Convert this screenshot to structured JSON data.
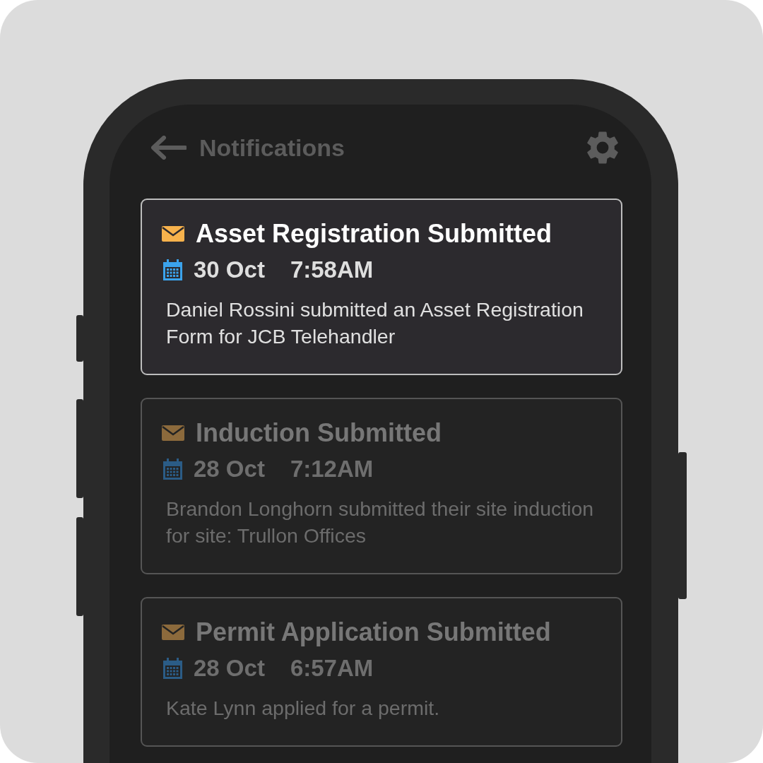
{
  "header": {
    "title": "Notifications"
  },
  "notifications": [
    {
      "title": "Asset Registration Submitted",
      "date": "30 Oct",
      "time": "7:58AM",
      "message": "Daniel Rossini submitted an Asset Registration Form for JCB Telehandler",
      "unread": true
    },
    {
      "title": "Induction Submitted",
      "date": "28 Oct",
      "time": "7:12AM",
      "message": "Brandon Longhorn submitted their site induction for site: Trullon Offices",
      "unread": false
    },
    {
      "title": "Permit Application Submitted",
      "date": "28 Oct",
      "time": "6:57AM",
      "message": "Kate Lynn applied for a permit.",
      "unread": false
    }
  ]
}
